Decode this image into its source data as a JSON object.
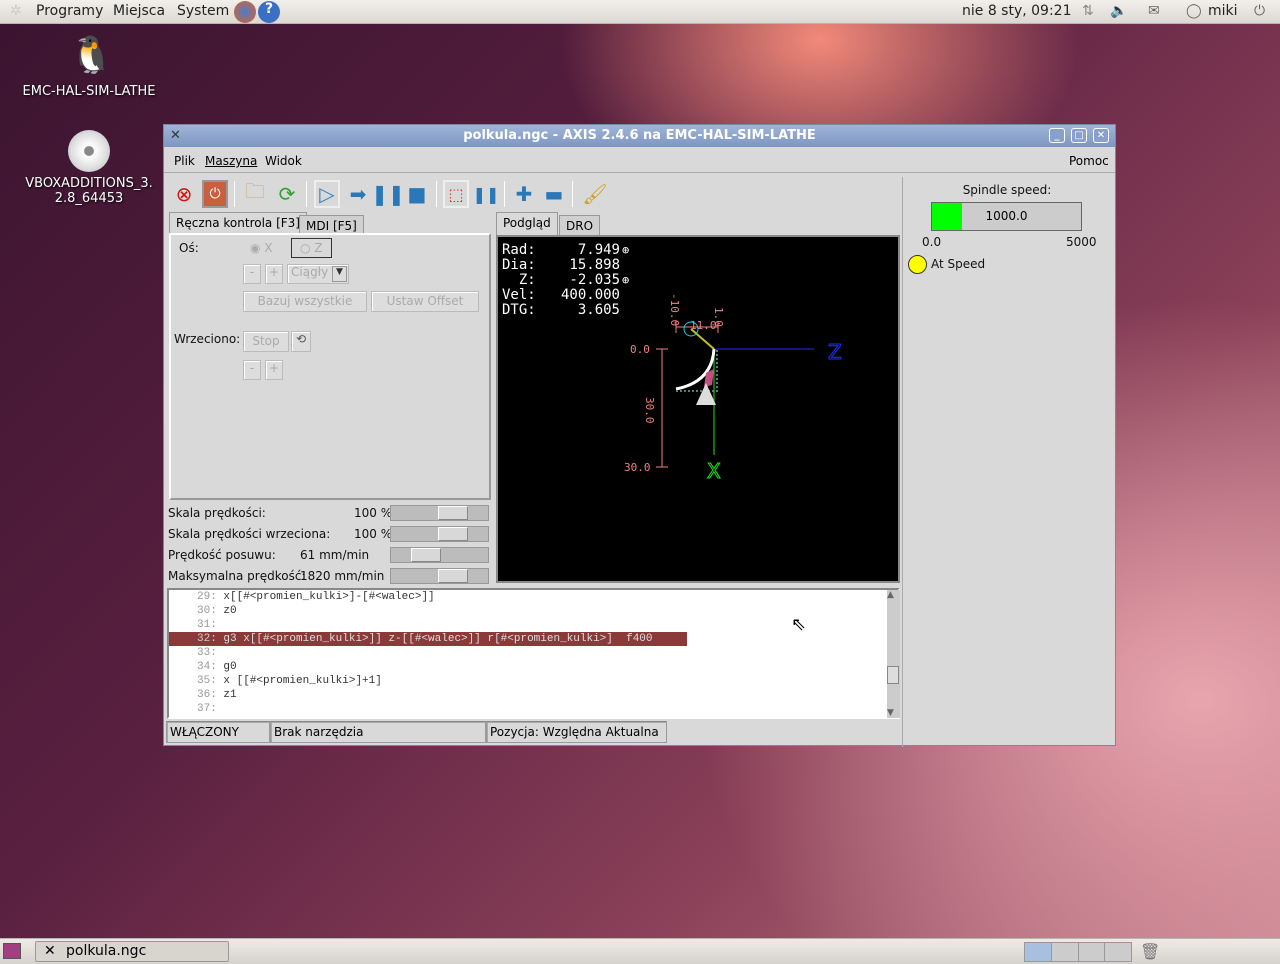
{
  "top_panel": {
    "menus": [
      "Programy",
      "Miejsca",
      "System"
    ],
    "clock": "nie  8 sty, 09:21",
    "user": "miki"
  },
  "desktop": {
    "icons": [
      {
        "label": "EMC-HAL-SIM-LATHE"
      },
      {
        "label": "VBOXADDITIONS_3.2.8_64453"
      }
    ]
  },
  "window": {
    "title": "polkula.ngc - AXIS 2.4.6 na EMC-HAL-SIM-LATHE",
    "menu": [
      "Plik",
      "Maszyna",
      "Widok"
    ],
    "help": "Pomoc",
    "left_tabs": [
      "Ręczna kontrola [F3]",
      "MDI [F5]"
    ],
    "manual": {
      "axis_label": "Oś:",
      "axis_x": "X",
      "axis_z": "Z",
      "minus": "-",
      "plus": "+",
      "jog_mode": "Ciągły",
      "home_all": "Bazuj wszystkie",
      "set_offset": "Ustaw Offset",
      "spindle_label": "Wrzeciono:",
      "stop": "Stop"
    },
    "sliders": [
      {
        "label": "Skala prędkości:",
        "value": "100 %",
        "fraction": 0.7
      },
      {
        "label": "Skala prędkości wrzeciona:",
        "value": "100 %",
        "fraction": 0.7
      },
      {
        "label": "Prędkość posuwu:",
        "value": "61 mm/min",
        "fraction": 0.3
      },
      {
        "label": "Maksymalna prędkość:",
        "value": "1820 mm/min",
        "fraction": 0.7
      }
    ],
    "view_tabs": [
      "Podgląd",
      "DRO"
    ],
    "dro": [
      {
        "label": "Rad:",
        "value": "7.949"
      },
      {
        "label": "Dia:",
        "value": "15.898"
      },
      {
        "label": "  Z:",
        "value": "-2.035"
      },
      {
        "label": "Vel:",
        "value": "400.000"
      },
      {
        "label": "DTG:",
        "value": "3.605"
      }
    ],
    "preview_labels": {
      "x_top": "0.0",
      "x_bottom": "30.0",
      "x_mid": "30.0",
      "z_left": "-10.0",
      "z_right": "1.0",
      "z_mid": "11.0",
      "axis_z": "Z",
      "axis_x": "X"
    },
    "spindle": {
      "label": "Spindle speed:",
      "value": "1000.0",
      "min": "0.0",
      "max": "5000",
      "fraction": 0.2,
      "at_speed": "At Speed",
      "bar_color": "#00ff00",
      "led_color": "#ffff00"
    },
    "code": [
      {
        "n": "29:",
        "t": "x[[#<promien_kulki>]-[#<walec>]]"
      },
      {
        "n": "30:",
        "t": "z0"
      },
      {
        "n": "31:",
        "t": ""
      },
      {
        "n": "32:",
        "t": "g3 x[[#<promien_kulki>]] z-[[#<walec>]] r[#<promien_kulki>]  f400",
        "active": true
      },
      {
        "n": "33:",
        "t": ""
      },
      {
        "n": "34:",
        "t": "g0"
      },
      {
        "n": "35:",
        "t": "x [[#<promien_kulki>]+1]"
      },
      {
        "n": "36:",
        "t": "z1"
      },
      {
        "n": "37:",
        "t": ""
      }
    ],
    "status": [
      "WŁĄCZONY",
      "Brak narzędzia",
      "Pozycja: Względna Aktualna"
    ]
  },
  "taskbar": {
    "items": [
      "polkula.ngc"
    ]
  }
}
